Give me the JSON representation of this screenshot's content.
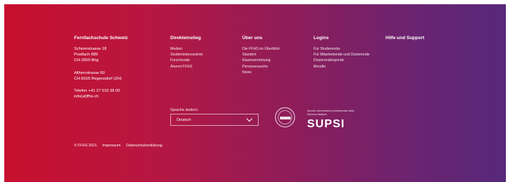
{
  "school": {
    "name": "Fernfachschule Schweiz",
    "address1": [
      "Schinerstrasse 18",
      "Postfach 689",
      "CH-3900 Brig"
    ],
    "address2": [
      "Altherrstrasse 60",
      "CH-8105 Regensdorf (ZH)"
    ],
    "contact": [
      "Telefon +41 27 510 38 00",
      "info(at)ffhs.ch"
    ]
  },
  "columns": [
    {
      "title": "Direkteinstieg",
      "items": [
        "Medien",
        "Studieninteressierte",
        "Forschende",
        "Alumni FFHS"
      ]
    },
    {
      "title": "Über uns",
      "items": [
        "Die FFHS im Überblick",
        "Standort",
        "Raumvermietung",
        "Personensuche",
        "News"
      ]
    },
    {
      "title": "Logins",
      "items": [
        "Für Studierende",
        "Für Mitarbeitende und Dozierende",
        "Dozierendenportal",
        "Moodle"
      ]
    },
    {
      "title": "Hilfe und Support",
      "items": []
    }
  ],
  "language": {
    "label": "Sprache ändern:",
    "selected": "Deutsch"
  },
  "supsi": {
    "caption": "Scuola universitaria professionale della Svizzera italiana",
    "logo": "SUPSI"
  },
  "footer": {
    "copyright": "© FFHS 2021.",
    "impressum": "Impressum.",
    "privacy": "Datenschutzerklärung"
  },
  "icons": {
    "seal": "accreditation-seal-icon",
    "chevron": "chevron-down-icon"
  },
  "colors": {
    "gradient_start": "#c8102e",
    "gradient_end": "#57287a"
  }
}
